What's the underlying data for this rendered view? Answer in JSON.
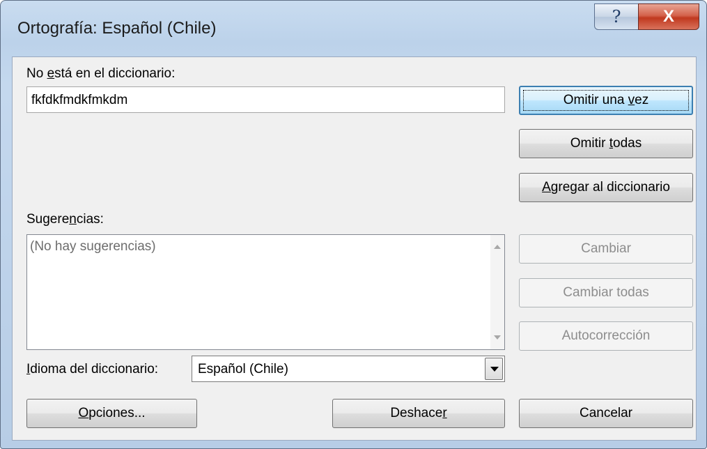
{
  "window": {
    "title": "Ortografía: Español (Chile)",
    "help_glyph": "?",
    "close_glyph": "X"
  },
  "not_in_dict": {
    "label_pre": "No ",
    "label_key": "e",
    "label_post": "stá en el diccionario:",
    "value": "fkfdkfmdkfmkdm"
  },
  "suggestions": {
    "label_pre": "Sugere",
    "label_key": "n",
    "label_post": "cias:",
    "empty_text": "(No hay sugerencias)"
  },
  "language": {
    "label_key": "I",
    "label_post": "dioma del diccionario:",
    "value": "Español (Chile)"
  },
  "buttons": {
    "ignore_once": {
      "pre": "Omitir una ",
      "key": "v",
      "post": "ez"
    },
    "ignore_all": {
      "pre": "Omitir ",
      "key": "t",
      "post": "odas"
    },
    "add_to_dict": {
      "pre": "",
      "key": "A",
      "post": "gregar al diccionario"
    },
    "change": "Cambiar",
    "change_all": "Cambiar todas",
    "autocorrect": "Autocorrección",
    "options": {
      "pre": "",
      "key": "O",
      "post": "pciones..."
    },
    "undo": {
      "pre": "Deshace",
      "key": "r",
      "post": ""
    },
    "cancel": "Cancelar"
  }
}
